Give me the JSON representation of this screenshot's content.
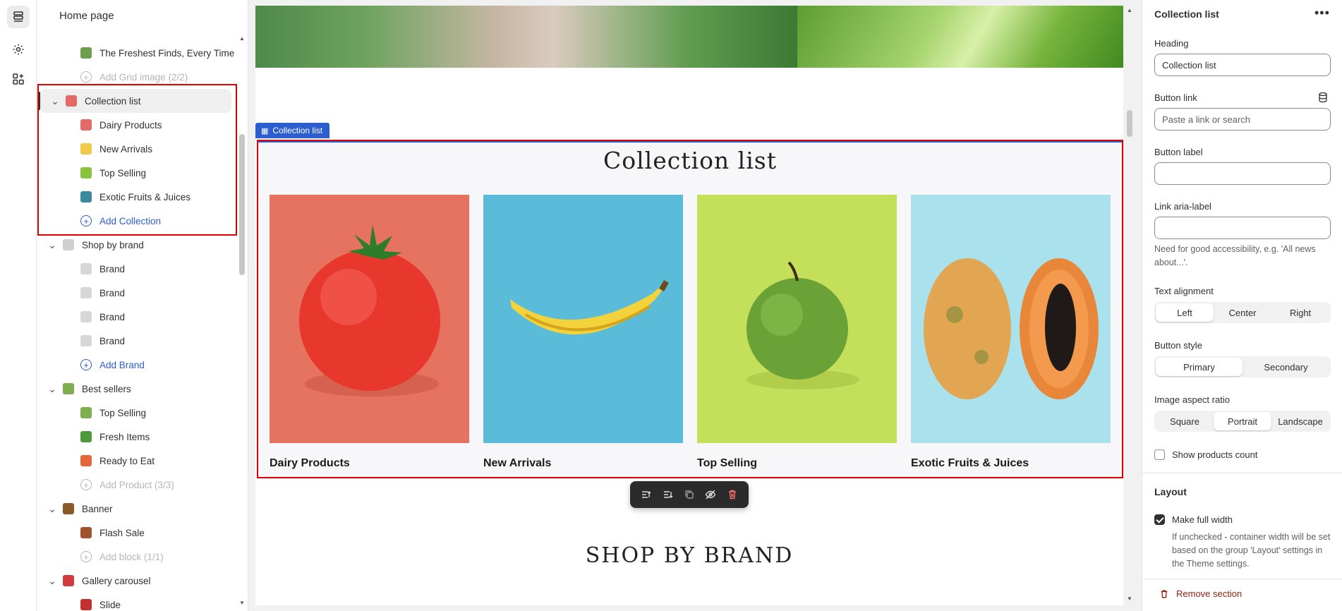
{
  "rail": {
    "items": [
      {
        "name": "sections-icon"
      },
      {
        "name": "settings-icon"
      },
      {
        "name": "apps-icon"
      }
    ]
  },
  "sidebar": {
    "title": "Home page",
    "rows": [
      {
        "level": 2,
        "label": "The Freshest Finds, Every Time",
        "thumb": "#6ca04a"
      },
      {
        "level": 2,
        "label": "Add Grid image (2/2)",
        "kind": "add-disabled"
      },
      {
        "level": 1,
        "label": "Collection list",
        "thumb": "#e46a6a",
        "selected": true,
        "open": true
      },
      {
        "level": 2,
        "label": "Dairy Products",
        "thumb": "#e46a6a"
      },
      {
        "level": 2,
        "label": "New Arrivals",
        "thumb": "#f0c94a"
      },
      {
        "level": 2,
        "label": "Top Selling",
        "thumb": "#8ac43f"
      },
      {
        "level": 2,
        "label": "Exotic Fruits & Juices",
        "thumb": "#3a8a9e"
      },
      {
        "level": 2,
        "label": "Add Collection",
        "kind": "add"
      },
      {
        "level": 1,
        "label": "Shop by brand",
        "thumb": "#cfcfcf",
        "open": true
      },
      {
        "level": 2,
        "label": "Brand",
        "thumb": "#d7d7d7"
      },
      {
        "level": 2,
        "label": "Brand",
        "thumb": "#d7d7d7"
      },
      {
        "level": 2,
        "label": "Brand",
        "thumb": "#d7d7d7"
      },
      {
        "level": 2,
        "label": "Brand",
        "thumb": "#d7d7d7"
      },
      {
        "level": 2,
        "label": "Add Brand",
        "kind": "add"
      },
      {
        "level": 1,
        "label": "Best sellers",
        "thumb": "#7fae4e",
        "open": true
      },
      {
        "level": 2,
        "label": "Top Selling",
        "thumb": "#7fae4e"
      },
      {
        "level": 2,
        "label": "Fresh Items",
        "thumb": "#4e9a3a"
      },
      {
        "level": 2,
        "label": "Ready to Eat",
        "thumb": "#e4673a"
      },
      {
        "level": 2,
        "label": "Add Product (3/3)",
        "kind": "add-disabled"
      },
      {
        "level": 1,
        "label": "Banner",
        "thumb": "#8b5a2b",
        "open": true
      },
      {
        "level": 2,
        "label": "Flash Sale",
        "thumb": "#a0522d"
      },
      {
        "level": 2,
        "label": "Add block (1/1)",
        "kind": "add-disabled"
      },
      {
        "level": 1,
        "label": "Gallery carousel",
        "thumb": "#d23b3b",
        "open": true
      },
      {
        "level": 2,
        "label": "Slide",
        "thumb": "#c23030"
      }
    ]
  },
  "canvas": {
    "section_tag": "Collection list",
    "heading": "Collection list",
    "cards": [
      {
        "label": "Dairy Products",
        "bg": "#e5735f"
      },
      {
        "label": "New Arrivals",
        "bg": "#6ec3dc"
      },
      {
        "label": "Top Selling",
        "bg": "#c2de5a"
      },
      {
        "label": "Exotic Fruits & Juices",
        "bg": "#a9e2ec"
      }
    ],
    "brand_heading": "SHOP BY BRAND"
  },
  "panel": {
    "title": "Collection list",
    "heading_label": "Heading",
    "heading_value": "Collection list",
    "button_link_label": "Button link",
    "button_link_placeholder": "Paste a link or search",
    "button_label_label": "Button label",
    "button_label_value": "",
    "aria_label": "Link aria-label",
    "aria_value": "",
    "aria_help": "Need for good accessibility, e.g. 'All news about...'.",
    "text_alignment_label": "Text alignment",
    "text_alignment_options": [
      "Left",
      "Center",
      "Right"
    ],
    "text_alignment_selected": "Left",
    "button_style_label": "Button style",
    "button_style_options": [
      "Primary",
      "Secondary"
    ],
    "button_style_selected": "Primary",
    "aspect_label": "Image aspect ratio",
    "aspect_options": [
      "Square",
      "Portrait",
      "Landscape"
    ],
    "aspect_selected": "Portrait",
    "show_count_label": "Show products count",
    "show_count_checked": false,
    "layout_section": "Layout",
    "full_width_label": "Make full width",
    "full_width_checked": true,
    "full_width_help": "If unchecked - container width will be set based on the group 'Layout' settings in the Theme settings.",
    "remove_label": "Remove section"
  },
  "colors": {
    "accent_blue": "#2c5ecf",
    "highlight_red": "#e00000",
    "danger": "#8e1f0b"
  }
}
